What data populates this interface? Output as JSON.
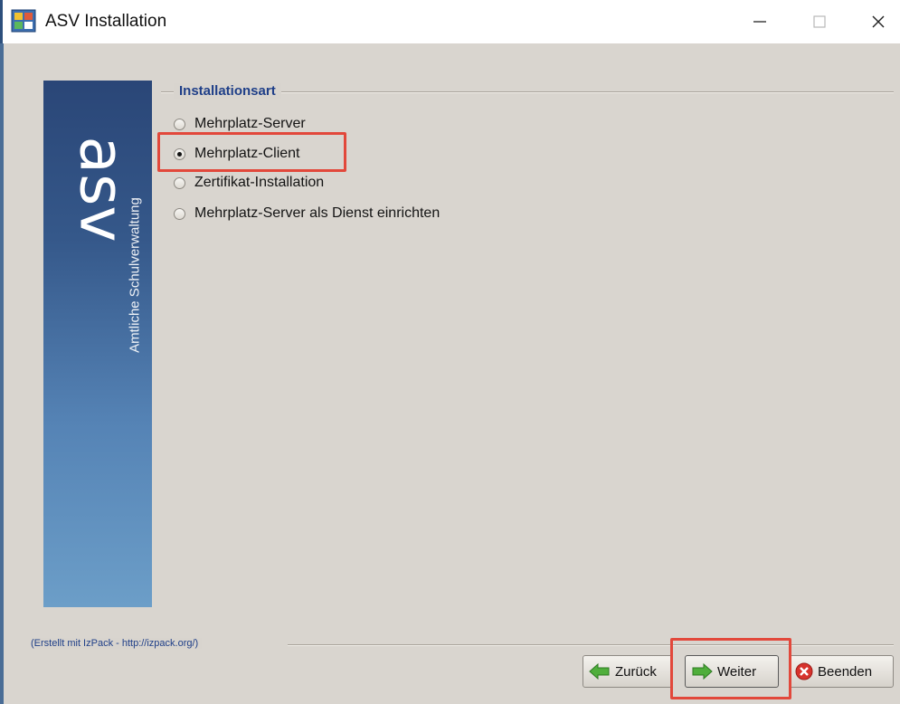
{
  "window": {
    "title": "ASV Installation"
  },
  "banner": {
    "logo_text": "asv",
    "subtitle": "Amtliche Schulverwaltung"
  },
  "installation_type": {
    "group_title": "Installationsart",
    "options": [
      {
        "label": "Mehrplatz-Server",
        "selected": false
      },
      {
        "label": "Mehrplatz-Client",
        "selected": true
      },
      {
        "label": "Zertifikat-Installation",
        "selected": false
      },
      {
        "label": "Mehrplatz-Server als Dienst einrichten",
        "selected": false
      }
    ]
  },
  "footer": {
    "credit": "(Erstellt mit IzPack - http://izpack.org/)"
  },
  "buttons": {
    "back": "Zurück",
    "next": "Weiter",
    "quit": "Beenden"
  },
  "icons": {
    "app": "asv-installer-icon",
    "back": "green-left-arrow-icon",
    "next": "green-right-arrow-icon",
    "quit": "red-x-circle-icon"
  },
  "colors": {
    "highlight": "#e2483b",
    "group_title": "#1f3f88",
    "banner_top": "#2a4677",
    "banner_bottom": "#6c9ec8"
  }
}
